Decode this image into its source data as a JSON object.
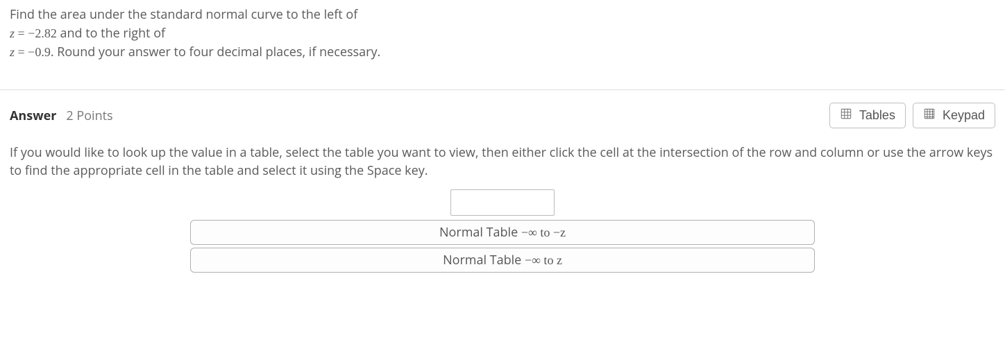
{
  "question": {
    "line1": "Find the area under the standard normal curve to the left of",
    "z1_var": "z",
    "z1_eq": " = ",
    "z1_neg": "−",
    "z1_val": "2.82",
    "line2_tail": " and to the right of",
    "z2_var": "z",
    "z2_eq": " = ",
    "z2_neg": "−",
    "z2_val": "0.9",
    "line3_tail": ". Round your answer to four decimal places, if necessary."
  },
  "answer_header": {
    "label": "Answer",
    "points": "2 Points"
  },
  "buttons": {
    "tables": "Tables",
    "keypad": "Keypad"
  },
  "instructions": "If you would like to look up the value in a table, select the table you want to view, then either click the cell at the intersection of the row and column or use the arrow keys to find the appropriate cell in the table and select it using the Space key.",
  "answer_input": {
    "value": ""
  },
  "table_buttons": {
    "neg": {
      "prefix": "Normal Table ",
      "range": "−∞ to −z"
    },
    "pos": {
      "prefix": "Normal Table ",
      "range": "−∞ to z"
    }
  }
}
